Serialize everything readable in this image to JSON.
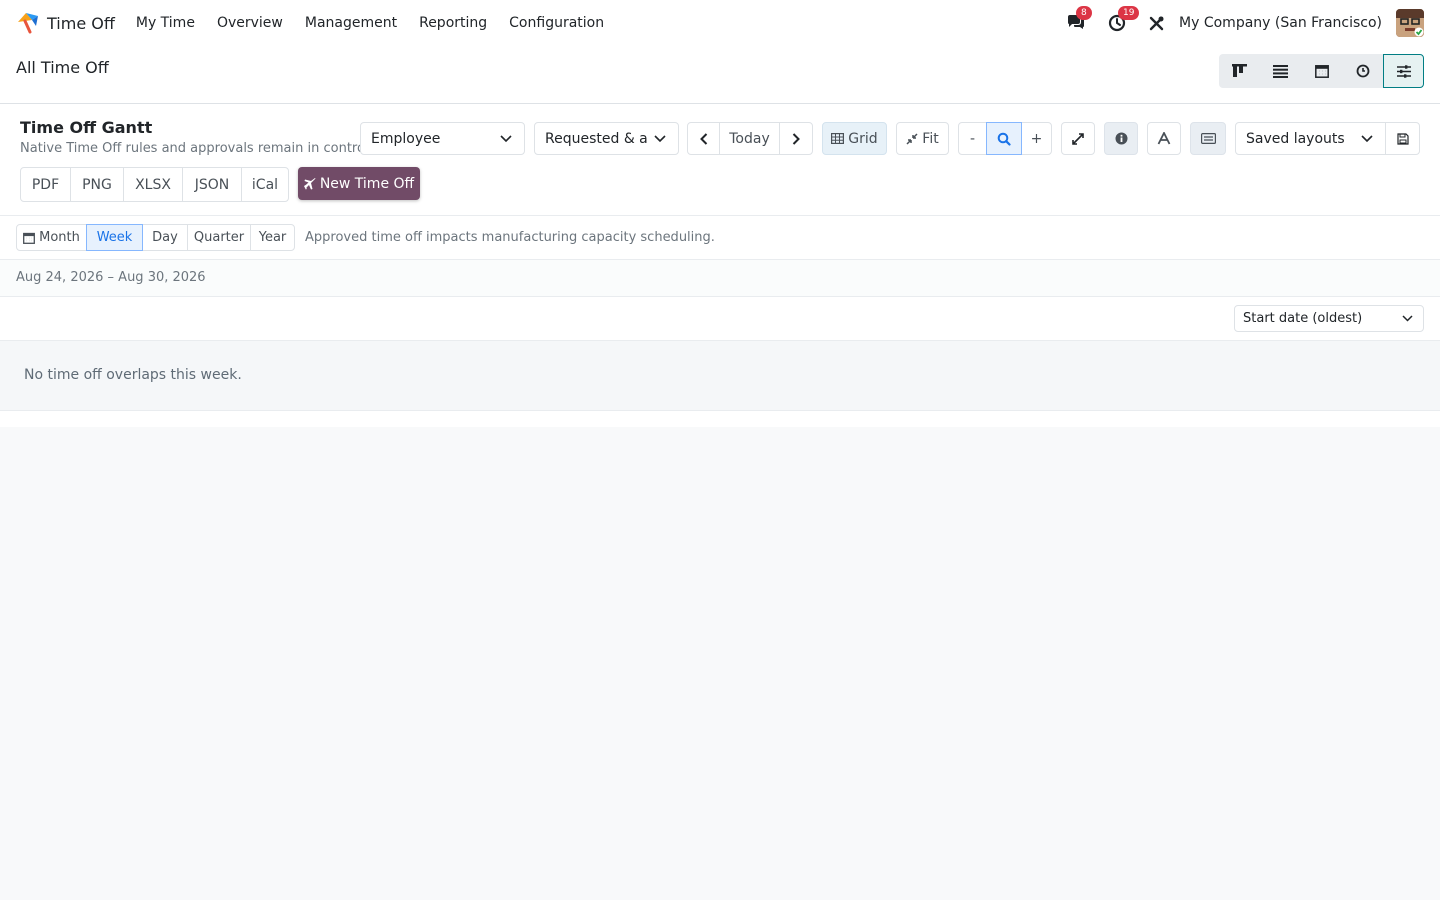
{
  "navbar": {
    "app_title": "Time Off",
    "menu": [
      "My Time",
      "Overview",
      "Management",
      "Reporting",
      "Configuration"
    ],
    "messages_count": "8",
    "activities_count": "19",
    "company": "My Company (San Francisco)"
  },
  "control_panel": {
    "breadcrumb": "All Time Off",
    "views": [
      "kanban-icon",
      "list-icon",
      "calendar-icon",
      "activity-icon",
      "gantt-settings-icon"
    ]
  },
  "gantt": {
    "title": "Time Off Gantt",
    "subtitle": "Native Time Off rules and approvals remain in control",
    "group_by": "Employee",
    "state_filter": "Requested & approved",
    "today_label": "Today",
    "grid_label": "Grid",
    "fit_label": "Fit",
    "zoom_out": "-",
    "zoom_in": "+",
    "saved_layouts": "Saved layouts",
    "exports": [
      "PDF",
      "PNG",
      "XLSX",
      "JSON",
      "iCal"
    ],
    "new_label": "New Time Off",
    "scales": {
      "month": "Month",
      "week": "Week",
      "day": "Day",
      "quarter": "Quarter",
      "year": "Year"
    },
    "active_scale": "Week",
    "scale_note": "Approved time off impacts manufacturing capacity scheduling.",
    "date_range": "Aug 24, 2026 – Aug 30, 2026",
    "sort": "Start date (oldest)",
    "empty_message": "No time off overlaps this week."
  },
  "colors": {
    "brand": "#714b67",
    "accent": "#017e84",
    "badge": "#dc3545",
    "active_scale": "#1a73e8"
  }
}
